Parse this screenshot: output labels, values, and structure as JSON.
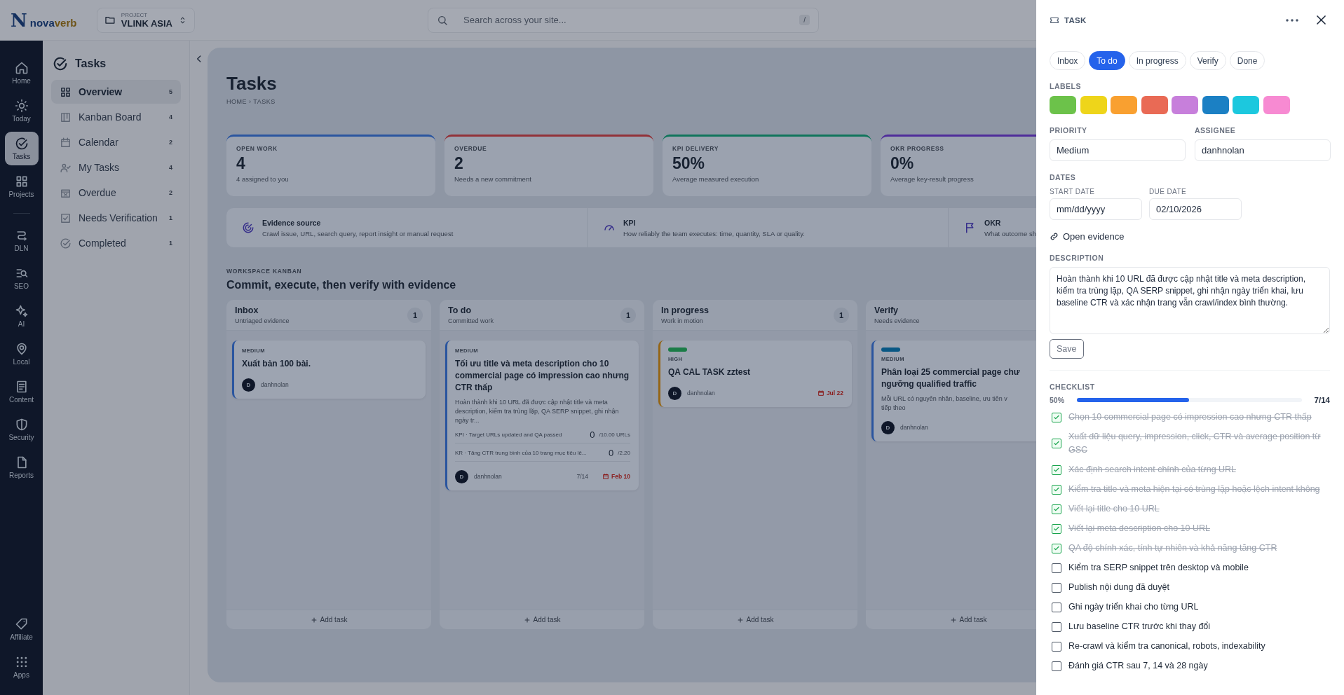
{
  "brand": {
    "mark": "N",
    "name_start": "nova",
    "name_end": "verb"
  },
  "project": {
    "caption": "PROJECT",
    "name": "VLINK ASIA"
  },
  "search": {
    "placeholder": "Search across your site...",
    "shortcut": "/"
  },
  "rail": {
    "main": [
      {
        "label": "Home",
        "selected": false
      },
      {
        "label": "Today",
        "selected": false
      },
      {
        "label": "Tasks",
        "selected": true
      },
      {
        "label": "Projects",
        "selected": false
      }
    ],
    "tools": [
      {
        "label": "DLN",
        "selected": false
      },
      {
        "label": "SEO",
        "selected": false
      },
      {
        "label": "AI",
        "selected": false
      },
      {
        "label": "Local",
        "selected": false
      },
      {
        "label": "Content",
        "selected": false
      },
      {
        "label": "Security",
        "selected": false
      },
      {
        "label": "Reports",
        "selected": false
      }
    ],
    "footer": [
      {
        "label": "Affiliate",
        "selected": false
      },
      {
        "label": "Apps",
        "selected": false
      }
    ]
  },
  "sidebar": {
    "title": "Tasks",
    "items": [
      {
        "label": "Overview",
        "count": "5",
        "selected": true
      },
      {
        "label": "Kanban Board",
        "count": "4",
        "selected": false
      },
      {
        "label": "Calendar",
        "count": "2",
        "selected": false
      },
      {
        "label": "My Tasks",
        "count": "4",
        "selected": false
      },
      {
        "label": "Overdue",
        "count": "2",
        "selected": false
      },
      {
        "label": "Needs Verification",
        "count": "1",
        "selected": false
      },
      {
        "label": "Completed",
        "count": "1",
        "selected": false
      }
    ]
  },
  "page": {
    "title": "Tasks",
    "breadcrumb": "HOME › TASKS"
  },
  "stats": [
    {
      "label": "OPEN WORK",
      "value": "4",
      "note": "4 assigned to you",
      "color": "#2a559f"
    },
    {
      "label": "OVERDUE",
      "value": "2",
      "note": "Needs a new commitment",
      "color": "#923138"
    },
    {
      "label": "KPI DELIVERY",
      "value": "50%",
      "note": "Average measured execution",
      "color": "#10755b"
    },
    {
      "label": "OKR PROGRESS",
      "value": "0%",
      "note": "Average key-result progress",
      "color": "#4f2c9a"
    }
  ],
  "info": [
    {
      "title": "Evidence source",
      "text": "Crawl issue, URL, search query, report insight or manual request"
    },
    {
      "title": "KPI",
      "text": "How reliably the team executes: time, quantity, SLA or quality."
    },
    {
      "title": "OKR",
      "text": "What outcome sh"
    }
  ],
  "kanban": {
    "caption": "WORKSPACE KANBAN",
    "title": "Commit, execute, then verify with evidence",
    "columns": [
      {
        "title": "Inbox",
        "subtitle": "Untriaged evidence",
        "count": "1",
        "add": "Add task",
        "cards": [
          {
            "priority": "MEDIUM",
            "title": "Xuất bản 100 bài.",
            "assignee": "danhnolan",
            "avatar": "D",
            "color": "#2a559f"
          }
        ]
      },
      {
        "title": "To do",
        "subtitle": "Committed work",
        "count": "1",
        "add": "Add task",
        "cards": [
          {
            "priority": "MEDIUM",
            "title": "Tối ưu title và meta description cho 10 commercial page có impression cao nhưng CTR thấp",
            "description": "Hoàn thành khi 10 URL đã được cập nhật title và meta description, kiểm tra trùng lặp, QA SERP snippet, ghi nhận ngày tr...",
            "metrics": [
              {
                "label": "KPI · Target URLs updated and QA passed",
                "value": "0",
                "target": "/10.00 URLs"
              },
              {
                "label": "KR · Tăng CTR trung bình của 10 trang mục tiêu lê...",
                "value": "0",
                "target": "/2.20"
              }
            ],
            "assignee": "danhnolan",
            "avatar": "D",
            "checklist": "7/14",
            "due": "Feb 10",
            "color": "#2a559f"
          }
        ]
      },
      {
        "title": "In progress",
        "subtitle": "Work in motion",
        "count": "1",
        "add": "Add task",
        "cards": [
          {
            "label": {
              "color": "#1b7c47"
            },
            "priority": "HIGH",
            "title": "QA CAL TASK zztest",
            "assignee": "danhnolan",
            "avatar": "D",
            "due": "Jul 22",
            "color": "#956617"
          }
        ]
      },
      {
        "title": "Verify",
        "subtitle": "Needs evidence",
        "add": "Add task",
        "cards": [
          {
            "label": {
              "color": "#085784"
            },
            "priority": "MEDIUM",
            "title": "Phân loại 25 commercial page chư\nngưỡng qualified traffic",
            "description": "Mỗi URL có nguyên nhân, baseline, ưu tiên v\ntiếp theo",
            "assignee": "danhnolan",
            "avatar": "D",
            "color": "#2a559f"
          }
        ]
      }
    ]
  },
  "panel": {
    "title": "TASK",
    "statuses": [
      {
        "label": "Inbox",
        "selected": false
      },
      {
        "label": "To do",
        "selected": true
      },
      {
        "label": "In progress",
        "selected": false
      },
      {
        "label": "Verify",
        "selected": false
      },
      {
        "label": "Done",
        "selected": false
      }
    ],
    "labels_caption": "LABELS",
    "labels": [
      {
        "color": "#6cc24a"
      },
      {
        "color": "#eed51a"
      },
      {
        "color": "#f9a030"
      },
      {
        "color": "#e96a55"
      },
      {
        "color": "#c77fdb"
      },
      {
        "color": "#1b80c4"
      },
      {
        "color": "#1cc8de"
      },
      {
        "color": "#f78ad2"
      }
    ],
    "priority": {
      "label": "PRIORITY",
      "value": "Medium"
    },
    "assignee": {
      "label": "ASSIGNEE",
      "value": "danhnolan"
    },
    "dates": {
      "label": "DATES",
      "start": {
        "label": "START DATE",
        "placeholder": "mm/dd/yyyy"
      },
      "due": {
        "label": "DUE DATE",
        "value": "02/10/2026"
      }
    },
    "evidence_link": "Open evidence",
    "description": {
      "label": "DESCRIPTION",
      "value": "Hoàn thành khi 10 URL đã được cập nhật title và meta description, kiểm tra trùng lặp, QA SERP snippet, ghi nhận ngày triển khai, lưu baseline CTR và xác nhận trang vẫn crawl/index bình thường."
    },
    "save": "Save",
    "checklist": {
      "label": "CHECKLIST",
      "percent": "50%",
      "level": 0.5,
      "count": "7/14",
      "items": [
        {
          "text": "Chọn 10 commercial page có impression cao nhưng CTR thấp",
          "checked": true
        },
        {
          "text": "Xuất dữ liệu query, impression, click, CTR và average position từ GSC",
          "checked": true
        },
        {
          "text": "Xác định search intent chính của từng URL",
          "checked": true
        },
        {
          "text": "Kiểm tra title và meta hiện tại có trùng lặp hoặc lệch intent không",
          "checked": true
        },
        {
          "text": "Viết lại title cho 10 URL",
          "checked": true
        },
        {
          "text": "Viết lại meta description cho 10 URL",
          "checked": true
        },
        {
          "text": "QA độ chính xác, tính tự nhiên và khả năng tăng CTR",
          "checked": true
        },
        {
          "text": "Kiểm tra SERP snippet trên desktop và mobile",
          "checked": false
        },
        {
          "text": "Publish nội dung đã duyệt",
          "checked": false
        },
        {
          "text": "Ghi ngày triển khai cho từng URL",
          "checked": false
        },
        {
          "text": "Lưu baseline CTR trước khi thay đổi",
          "checked": false
        },
        {
          "text": "Re-crawl và kiểm tra canonical, robots, indexability",
          "checked": false
        },
        {
          "text": "Đánh giá CTR sau 7, 14 và 28 ngày",
          "checked": false
        }
      ]
    }
  }
}
